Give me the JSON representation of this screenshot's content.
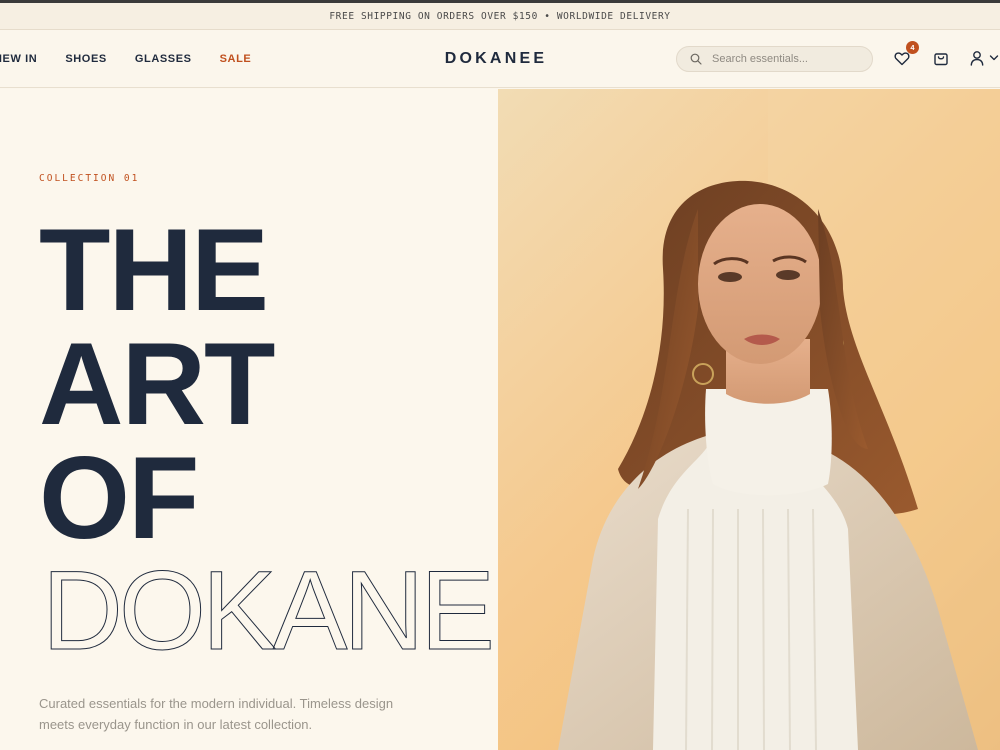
{
  "announcement": "FREE SHIPPING ON ORDERS OVER $150 • WORLDWIDE DELIVERY",
  "nav": {
    "items": [
      {
        "label": "NEW IN"
      },
      {
        "label": "SHOES"
      },
      {
        "label": "GLASSES"
      },
      {
        "label": "SALE"
      }
    ]
  },
  "brand": "DOKANEE",
  "search": {
    "placeholder": "Search essentials..."
  },
  "wishlist": {
    "count": "4"
  },
  "colors": {
    "accent": "#c0501e",
    "ink": "#1f2a3d",
    "background": "#fbf6ec"
  },
  "hero": {
    "eyebrow": "COLLECTION 01",
    "headline": [
      "THE",
      "ART",
      "OF"
    ],
    "outline_word": "DOKANEE",
    "description": "Curated essentials for the modern individual. Timeless design meets everyday function in our latest collection."
  },
  "icons": [
    "search-icon",
    "heart-icon",
    "bag-icon",
    "user-icon",
    "chevron-down-icon"
  ]
}
